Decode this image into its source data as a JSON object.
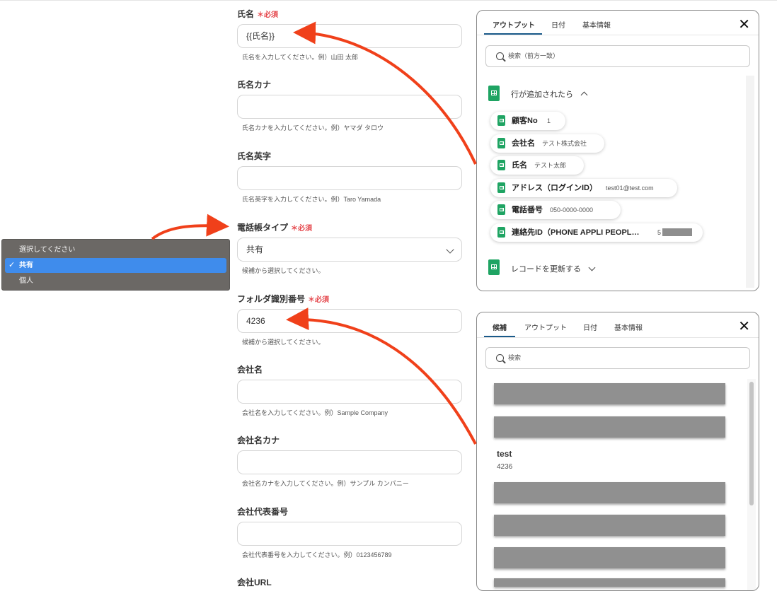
{
  "form": {
    "fields": [
      {
        "label": "氏名",
        "required": true,
        "required_text": "＊必須",
        "value": "{{氏名}}",
        "hint": "氏名を入力してください。例）山田 太郎"
      },
      {
        "label": "氏名カナ",
        "required": false,
        "value": "",
        "hint": "氏名カナを入力してください。例）ヤマダ タロウ"
      },
      {
        "label": "氏名英字",
        "required": false,
        "value": "",
        "hint": "氏名英字を入力してください。例）Taro Yamada"
      },
      {
        "label": "電話帳タイプ",
        "required": true,
        "required_text": "＊必須",
        "value": "共有",
        "hint": "候補から選択してください。",
        "type": "select"
      },
      {
        "label": "フォルダ識別番号",
        "required": true,
        "required_text": "＊必須",
        "value": "4236",
        "hint": "候補から選択してください。"
      },
      {
        "label": "会社名",
        "required": false,
        "value": "",
        "hint": "会社名を入力してください。例）Sample Company"
      },
      {
        "label": "会社名カナ",
        "required": false,
        "value": "",
        "hint": "会社名カナを入力してください。例）サンプル カンパニー"
      },
      {
        "label": "会社代表番号",
        "required": false,
        "value": "",
        "hint": "会社代表番号を入力してください。例）0123456789"
      },
      {
        "label": "会社URL",
        "required": false,
        "value": "",
        "hint": ""
      }
    ]
  },
  "dropdown": {
    "options": [
      {
        "label": "選択してください",
        "selected": false
      },
      {
        "label": "共有",
        "selected": true
      },
      {
        "label": "個人",
        "selected": false
      }
    ],
    "check": "✓"
  },
  "output_panel": {
    "tabs": [
      "アウトプット",
      "日付",
      "基本情報"
    ],
    "active_tab": 0,
    "close": "✕",
    "search_placeholder": "検索（前方一致）",
    "section1": "行が追加されたら",
    "section2": "レコードを更新する",
    "items": [
      {
        "name": "顧客No",
        "value": "1"
      },
      {
        "name": "会社名",
        "value": "テスト株式会社"
      },
      {
        "name": "氏名",
        "value": "テスト太郎"
      },
      {
        "name": "アドレス（ログインID）",
        "value": "test01@test.com"
      },
      {
        "name": "電話番号",
        "value": "050-0000-0000"
      },
      {
        "name": "連絡先ID（PHONE APPLI PEOPL…",
        "value": "5"
      }
    ]
  },
  "candidate_panel": {
    "tabs": [
      "候補",
      "アウトプット",
      "日付",
      "基本情報"
    ],
    "active_tab": 0,
    "close": "✕",
    "search_placeholder": "検索",
    "candidate": {
      "title": "test",
      "value": "4236"
    }
  },
  "colors": {
    "accent_arrow": "#f0401a",
    "required": "#e5484d",
    "sheet_green": "#1fa463",
    "tab_underline": "#1a5a8a",
    "dropdown_selected": "#3f8cec"
  }
}
